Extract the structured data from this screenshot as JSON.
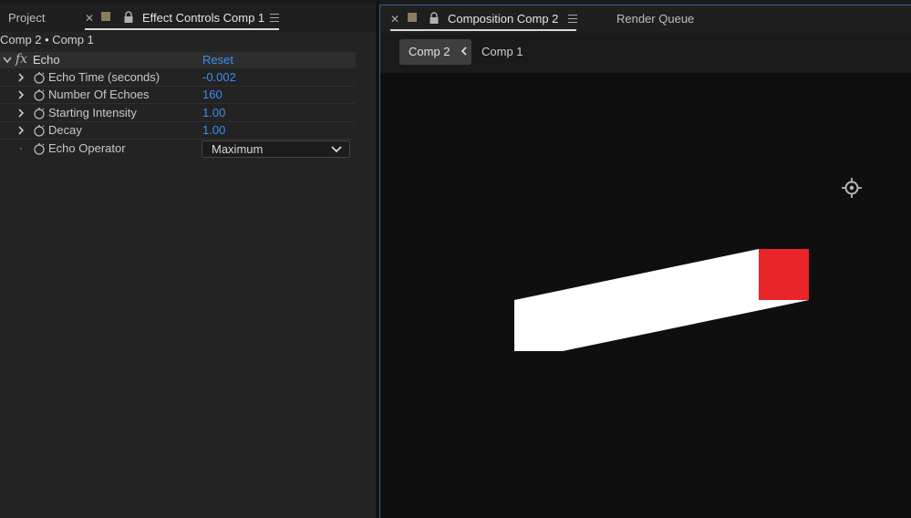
{
  "left_panel": {
    "tabs": [
      {
        "label": "Project"
      },
      {
        "label": "Effect Controls Comp 1"
      }
    ],
    "breadcrumb": "Comp 2 • Comp 1",
    "effect": {
      "fx_label": "fx",
      "name": "Echo",
      "reset_label": "Reset",
      "properties": [
        {
          "label": "Echo Time (seconds)",
          "value": "-0.002"
        },
        {
          "label": "Number Of Echoes",
          "value": "160"
        },
        {
          "label": "Starting Intensity",
          "value": "1.00"
        },
        {
          "label": "Decay",
          "value": "1.00"
        },
        {
          "label": "Echo Operator",
          "value": "Maximum"
        }
      ]
    }
  },
  "right_panel": {
    "tabs": [
      {
        "label": "Composition Comp 2"
      },
      {
        "label": "Render Queue"
      }
    ],
    "flowchart": {
      "current": "Comp 2",
      "next": "Comp 1"
    }
  },
  "colors": {
    "accent_blue": "#3b8df4",
    "swatch": "#8d7b62",
    "layer_white": "#ffffff",
    "layer_red": "#e8262a",
    "viewer_bg": "#0f0f0f"
  },
  "icons": {
    "close": "close-icon",
    "lock": "lock-icon",
    "menu": "panel-menu-icon",
    "stopwatch": "stopwatch-icon",
    "twirl": "chevron-right-icon",
    "dropdown": "chevron-down-icon",
    "crosshair": "target-icon"
  }
}
